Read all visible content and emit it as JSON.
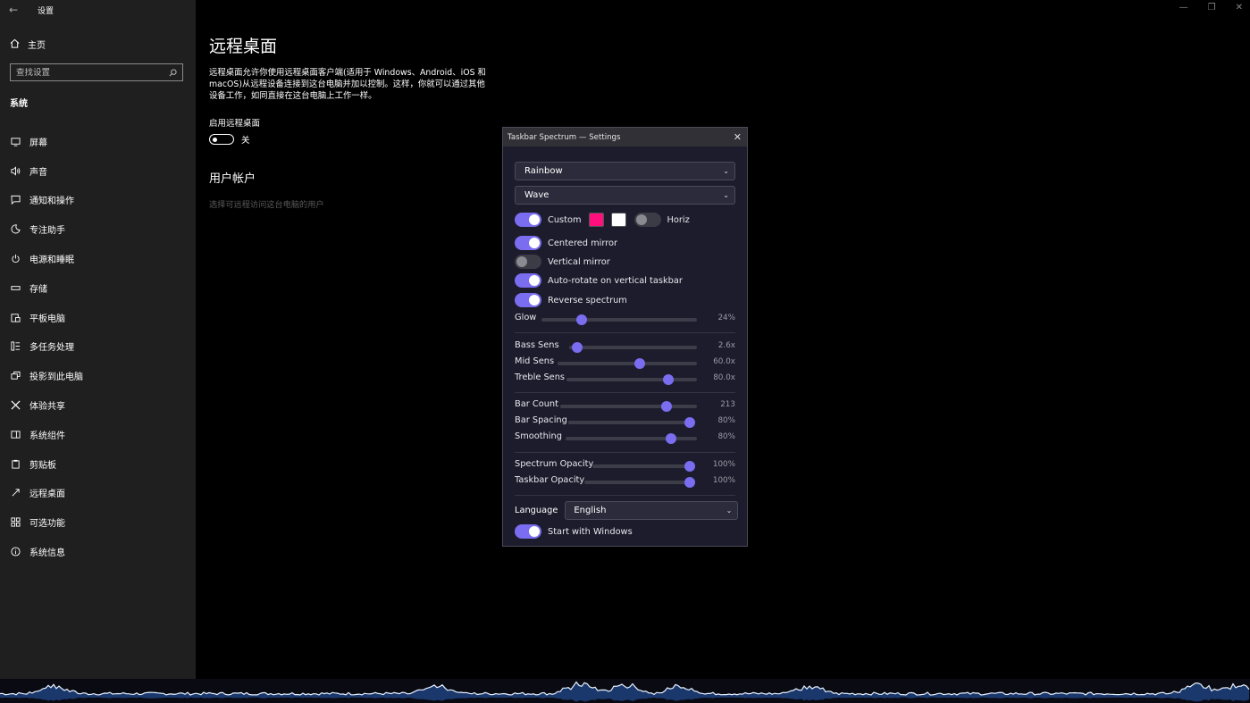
{
  "settings": {
    "app_title": "设置",
    "home_label": "主页",
    "search_placeholder": "查找设置",
    "section": "系统",
    "nav": [
      {
        "label": "屏幕",
        "icon": "monitor-icon"
      },
      {
        "label": "声音",
        "icon": "speaker-icon"
      },
      {
        "label": "通知和操作",
        "icon": "notification-icon"
      },
      {
        "label": "专注助手",
        "icon": "moon-icon"
      },
      {
        "label": "电源和睡眠",
        "icon": "power-icon"
      },
      {
        "label": "存储",
        "icon": "storage-icon"
      },
      {
        "label": "平板电脑",
        "icon": "tablet-icon"
      },
      {
        "label": "多任务处理",
        "icon": "multitask-icon"
      },
      {
        "label": "投影到此电脑",
        "icon": "project-icon"
      },
      {
        "label": "体验共享",
        "icon": "share-icon"
      },
      {
        "label": "系统组件",
        "icon": "components-icon"
      },
      {
        "label": "剪贴板",
        "icon": "clipboard-icon"
      },
      {
        "label": "远程桌面",
        "icon": "remote-icon"
      },
      {
        "label": "可选功能",
        "icon": "features-icon"
      },
      {
        "label": "系统信息",
        "icon": "info-icon"
      }
    ],
    "active_nav": "远程桌面"
  },
  "page": {
    "title": "远程桌面",
    "description": "远程桌面允许你使用远程桌面客户端(适用于 Windows、Android、iOS 和 macOS)从远程设备连接到这台电脑并加以控制。这样，你就可以通过其他设备工作，如同直接在这台电脑上工作一样。",
    "enable_label": "启用远程桌面",
    "toggle_state": "关",
    "accounts_title": "用户帐户",
    "accounts_link": "选择可远程访问这台电脑的用户"
  },
  "dialog": {
    "title": "Taskbar Spectrum — Settings",
    "color_scheme": "Rainbow",
    "style": "Wave",
    "custom_label": "Custom",
    "custom_on": true,
    "swatch1": "#ff0f7b",
    "swatch2": "#ffffff",
    "horiz_label": "Horiz",
    "horiz_on": false,
    "centered_mirror": "Centered mirror",
    "vertical_mirror": "Vertical mirror",
    "auto_rotate": "Auto-rotate on vertical taskbar",
    "reverse_spectrum": "Reverse spectrum",
    "sliders": [
      {
        "label": "Glow",
        "value": "24%",
        "pos": 0.26
      },
      {
        "label": "Bass Sens",
        "value": "2.6x",
        "pos": 0.06
      },
      {
        "label": "Mid Sens",
        "value": "60.0x",
        "pos": 0.59
      },
      {
        "label": "Treble Sens",
        "value": "80.0x",
        "pos": 0.78
      },
      {
        "label": "Bar Count",
        "value": "213",
        "pos": 0.78
      },
      {
        "label": "Bar Spacing",
        "value": "80%",
        "pos": 1.0
      },
      {
        "label": "Smoothing",
        "value": "80%",
        "pos": 0.8
      },
      {
        "label": "Spectrum Opacity",
        "value": "100%",
        "pos": 1.0
      },
      {
        "label": "Taskbar Opacity",
        "value": "100%",
        "pos": 1.0
      }
    ],
    "language_label": "Language",
    "language": "English",
    "start_with_windows": "Start with Windows",
    "accent": "#7a6df0"
  }
}
